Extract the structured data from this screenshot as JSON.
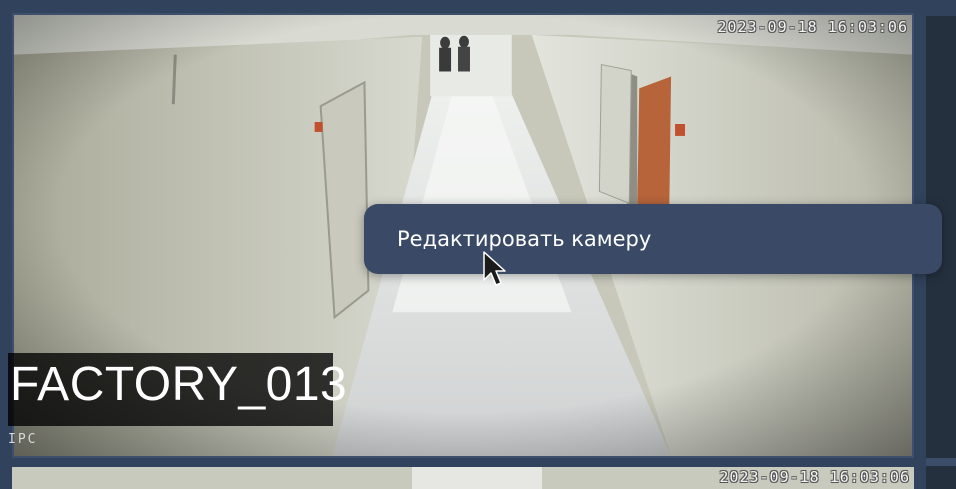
{
  "camera_tile": {
    "timestamp": "2023-09-18 16:03:06",
    "name": "FACTORY_013",
    "type": "IPC"
  },
  "next_tile": {
    "timestamp": "2023-09-18 16:03:06"
  },
  "context_menu": {
    "items": [
      {
        "label": "Редактировать камеру"
      }
    ]
  },
  "colors": {
    "background": "#31425d",
    "menu_background": "#3a4a66",
    "label_background": "#000000"
  }
}
